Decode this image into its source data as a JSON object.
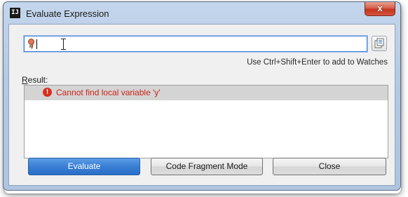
{
  "window": {
    "app_icon": "IJ",
    "title": "Evaluate Expression",
    "close_glyph": "x"
  },
  "expression": {
    "value": "",
    "error_marker_icon": "error-lightbulb-icon",
    "history_icon": "expression-history-icon"
  },
  "hint": "Use Ctrl+Shift+Enter to add to Watches",
  "result": {
    "label_prefix": "R",
    "label_rest": "esult:",
    "items": [
      {
        "icon": "error-icon",
        "text": "Cannot find local variable 'y'"
      }
    ]
  },
  "buttons": {
    "evaluate": "Evaluate",
    "code_fragment": "Code Fragment Mode",
    "close": "Close"
  },
  "colors": {
    "accent": "#3a7fd4",
    "error": "#cc2318"
  }
}
